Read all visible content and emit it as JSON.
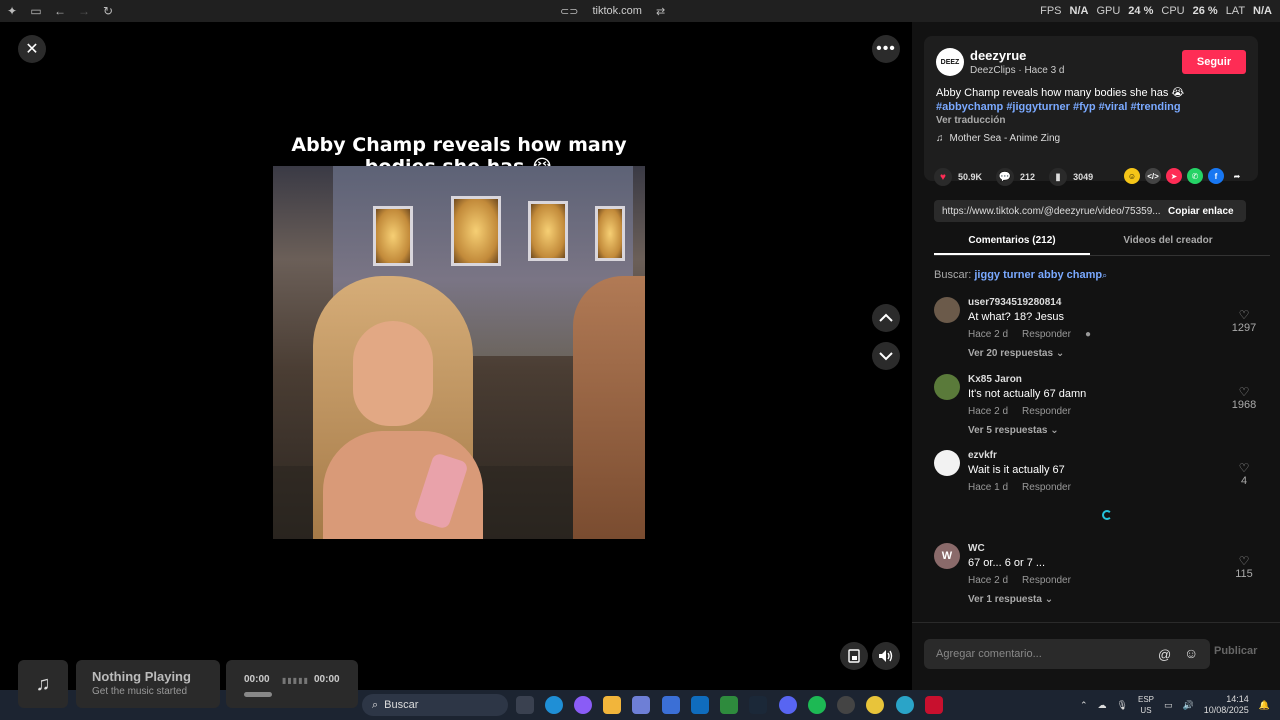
{
  "titlebar": {
    "url": "tiktok.com"
  },
  "perf": {
    "fps_label": "FPS",
    "fps_value": "N/A",
    "gpu_label": "GPU",
    "gpu_value": "24 %",
    "cpu_label": "CPU",
    "cpu_value": "26 %",
    "lat_label": "LAT",
    "lat_value": "N/A"
  },
  "search": {
    "value": "jiggy turner abby champ"
  },
  "video": {
    "caption": "Abby Champ reveals how many bodies she has 😭"
  },
  "post": {
    "avatar_text": "DEEZ",
    "author": "deezyrue",
    "subline": "DeezClips · Hace 3 d",
    "follow_label": "Seguir",
    "description": "Abby Champ reveals how many bodies she has 😭",
    "tags": [
      "#abbychamp",
      "#jiggyturner",
      "#fyp",
      "#viral",
      "#trending"
    ],
    "translate_label": "Ver traducción",
    "music": "Mother Sea - Anime Zing",
    "likes": "50.9K",
    "comments": "212",
    "saves": "3049",
    "link": "https://www.tiktok.com/@deezyrue/video/75359...",
    "copy_label": "Copiar enlace"
  },
  "tabs": {
    "comments": "Comentarios (212)",
    "creator": "Videos del creador"
  },
  "search_for": {
    "label": "Buscar:",
    "query": "jiggy turner abby champ"
  },
  "comments": [
    {
      "user": "user7934519280814",
      "text": "At what? 18? Jesus",
      "time": "Hace 2 d",
      "reply": "Responder",
      "replies": "Ver 20 respuestas",
      "likes": "1297",
      "avatar": "",
      "avatar_color": "#6b5a4a"
    },
    {
      "user": "Kx85 Jaron",
      "text": "It's not actually 67 damn",
      "time": "Hace 2 d",
      "reply": "Responder",
      "replies": "Ver 5 respuestas",
      "likes": "1968",
      "avatar": "",
      "avatar_color": "#5a7a3a"
    },
    {
      "user": "ezvkfr",
      "text": "Wait is it actually 67",
      "time": "Hace 1 d",
      "reply": "Responder",
      "replies": "",
      "likes": "4",
      "avatar": "",
      "avatar_color": "#f2f2f2"
    },
    {
      "user": "WC",
      "text": "67 or... 6 or 7 ...",
      "time": "Hace 2 d",
      "reply": "Responder",
      "replies": "Ver 1 respuesta",
      "likes": "115",
      "avatar": "W",
      "avatar_color": "#8a6a6a"
    }
  ],
  "comment_input": {
    "placeholder": "Agregar comentario...",
    "publish_label": "Publicar"
  },
  "now_playing": {
    "title": "Nothing Playing",
    "subtitle": "Get the music started",
    "time_start": "00:00",
    "time_end": "00:00",
    "progress": 0.2
  },
  "taskbar": {
    "search_label": "Buscar",
    "lang_1": "ESP",
    "lang_2": "US",
    "time": "14:14",
    "date": "10/08/2025"
  },
  "colors": {
    "accent": "#fe2c55",
    "link": "#7aa9ff",
    "panel": "#121212"
  }
}
